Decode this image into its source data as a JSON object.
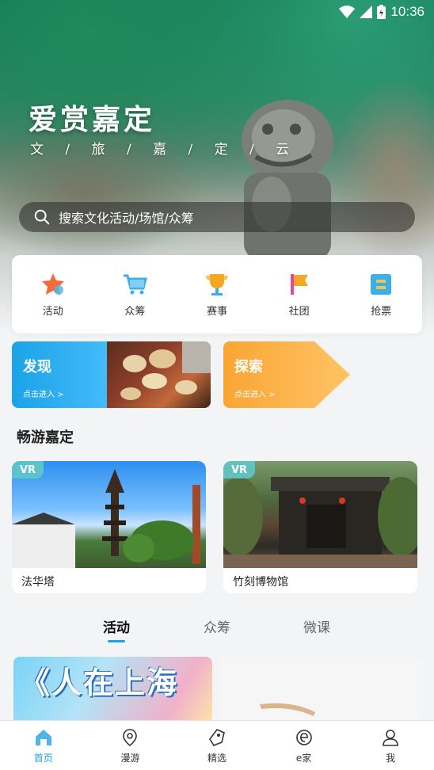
{
  "status": {
    "time": "10:36"
  },
  "hero": {
    "title": "爱赏嘉定",
    "subtitle": "文 / 旅 / 嘉 / 定 / 云"
  },
  "search": {
    "placeholder": "搜索文化活动/场馆/众筹"
  },
  "quick_menu": [
    {
      "label": "活动",
      "icon": "star-icon",
      "color": "#f46b3a"
    },
    {
      "label": "众筹",
      "icon": "cart-icon",
      "color": "#3bb0e8"
    },
    {
      "label": "赛事",
      "icon": "trophy-icon",
      "color": "#f5a623"
    },
    {
      "label": "社团",
      "icon": "flag-icon",
      "color": "#f5a623"
    },
    {
      "label": "抢票",
      "icon": "ticket-icon",
      "color": "#3bb0e8"
    }
  ],
  "cards": {
    "discover": {
      "title": "发现",
      "sub": "点击进入 >"
    },
    "explore": {
      "title": "探索",
      "sub": "点击进入 >"
    }
  },
  "section": {
    "title": "畅游嘉定"
  },
  "places": [
    {
      "badge": "VR",
      "name": "法华塔"
    },
    {
      "badge": "VR",
      "name": "竹刻博物馆"
    }
  ],
  "tabs": [
    {
      "label": "活动",
      "active": true
    },
    {
      "label": "众筹",
      "active": false
    },
    {
      "label": "微课",
      "active": false
    }
  ],
  "activities": [
    {
      "title": "《人在上海"
    }
  ],
  "bottom_nav": [
    {
      "label": "首页",
      "icon": "home-icon",
      "active": true
    },
    {
      "label": "漫游",
      "icon": "location-icon",
      "active": false
    },
    {
      "label": "精选",
      "icon": "tag-icon",
      "active": false
    },
    {
      "label": "e家",
      "icon": "e-home-icon",
      "active": false
    },
    {
      "label": "我",
      "icon": "user-icon",
      "active": false
    }
  ],
  "colors": {
    "accent": "#1a9be0",
    "discover": "#1aa3e8",
    "explore": "#f9a533"
  }
}
